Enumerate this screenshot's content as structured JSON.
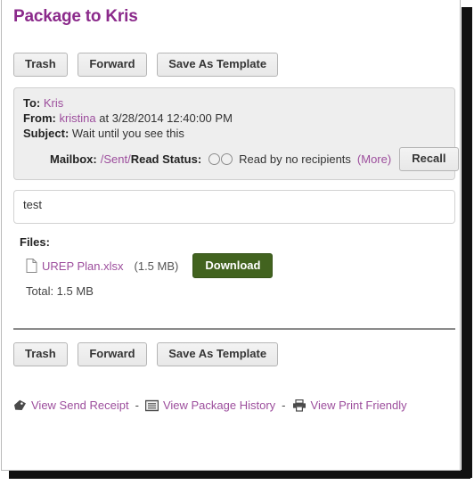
{
  "page": {
    "title": "Package to Kris"
  },
  "toolbar_top": {
    "buttons": [
      {
        "label": "Trash",
        "name": "trash-button"
      },
      {
        "label": "Forward",
        "name": "forward-button"
      },
      {
        "label": "Save As Template",
        "name": "save-as-template-button"
      }
    ]
  },
  "toolbar_bottom": {
    "buttons": [
      {
        "label": "Trash",
        "name": "trash-button"
      },
      {
        "label": "Forward",
        "name": "forward-button"
      },
      {
        "label": "Save As Template",
        "name": "save-as-template-button"
      }
    ]
  },
  "info": {
    "to_label": "To:",
    "to_value": "Kris",
    "from_label": "From:",
    "from_value": "kristina",
    "from_at": "at 3/28/2014 12:40:00 PM",
    "subject_label": "Subject:",
    "subject_value": "Wait until you see this",
    "mailbox_label": "Mailbox:",
    "mailbox_value": "/Sent/",
    "read_status_label": "Read Status:",
    "read_status_text": "Read by no recipients",
    "more_link": "(More)",
    "recall_label": "Recall"
  },
  "message": {
    "body": "test"
  },
  "files": {
    "heading": "Files:",
    "items": [
      {
        "name": "UREP Plan.xlsx",
        "size": "(1.5 MB)",
        "download_label": "Download",
        "icon": "file-icon"
      }
    ],
    "total": "Total: 1.5 MB"
  },
  "footer": {
    "separator": "-",
    "links": [
      {
        "label": "View Send Receipt",
        "icon": "tag-icon"
      },
      {
        "label": "View Package History",
        "icon": "history-document-icon"
      },
      {
        "label": "View Print Friendly",
        "icon": "printer-icon"
      }
    ]
  },
  "colors": {
    "title": "#8b2a8b",
    "link": "#9c4d9c",
    "download_button": "#42631f",
    "panel_background": "#eeeeee"
  }
}
